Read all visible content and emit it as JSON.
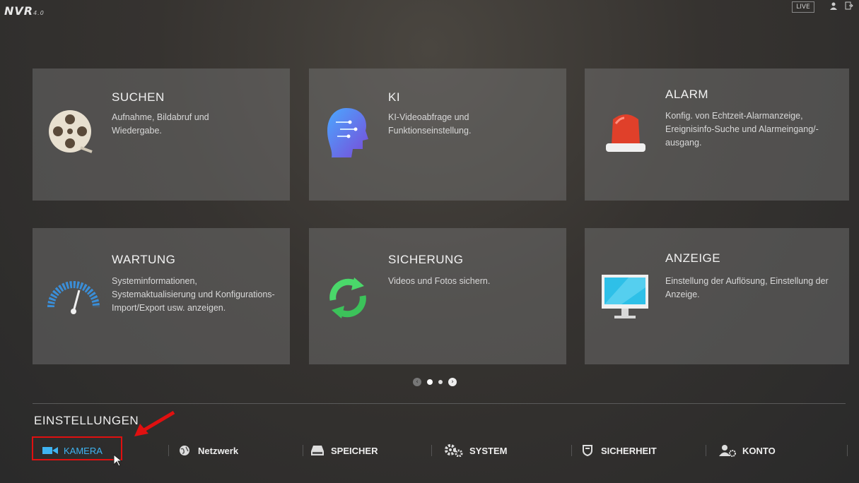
{
  "header": {
    "logo": "NVR",
    "logo_version": "4.0",
    "live_label": "LIVE",
    "user_icon": "user-icon",
    "logout_icon": "logout-icon"
  },
  "tiles": [
    {
      "title": "SUCHEN",
      "desc": "Aufnahme, Bildabruf und Wiedergabe.",
      "icon": "film-reel-icon"
    },
    {
      "title": "KI",
      "desc": "KI-Videoabfrage und Funktionseinstellung.",
      "icon": "ai-head-icon"
    },
    {
      "title": "ALARM",
      "desc": "Konfig. von Echtzeit-Alarmanzeige, Ereignisinfo-Suche und Alarmeingang/-ausgang.",
      "icon": "alarm-light-icon"
    },
    {
      "title": "WARTUNG",
      "desc": "Systeminformationen, Systemaktualisierung und Konfigurations-Import/Export usw. anzeigen.",
      "icon": "gauge-icon"
    },
    {
      "title": "SICHERUNG",
      "desc": "Videos und Fotos sichern.",
      "icon": "sync-icon"
    },
    {
      "title": "ANZEIGE",
      "desc": "Einstellung der Auflösung, Einstellung der Anzeige.",
      "icon": "monitor-icon"
    }
  ],
  "pager": {
    "pages": 2,
    "active_page": 1
  },
  "settings": {
    "title": "EINSTELLUNGEN",
    "items": [
      {
        "label": "KAMERA",
        "icon": "camera-icon",
        "active": true
      },
      {
        "label": "Netzwerk",
        "icon": "globe-icon",
        "active": false
      },
      {
        "label": "SPEICHER",
        "icon": "hdd-icon",
        "active": false
      },
      {
        "label": "SYSTEM",
        "icon": "gears-icon",
        "active": false
      },
      {
        "label": "SICHERHEIT",
        "icon": "shield-icon",
        "active": false
      },
      {
        "label": "KONTO",
        "icon": "users-icon",
        "active": false
      }
    ]
  },
  "colors": {
    "accent": "#3fb3f0",
    "highlight": "#e01010",
    "tile_bg": "#787878"
  }
}
